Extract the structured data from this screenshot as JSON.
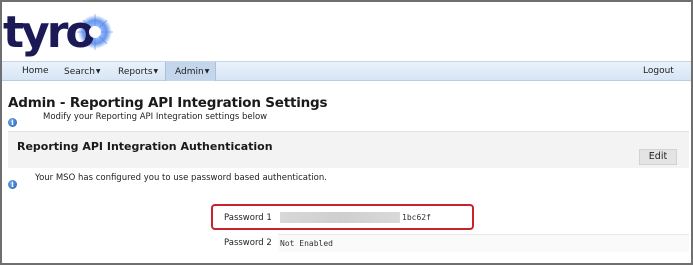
{
  "brand": {
    "logo_text": "tyro",
    "accent": "#1b1a57",
    "burst": "#2f6fe6"
  },
  "nav": {
    "items": [
      {
        "label": "Home",
        "has_caret": false
      },
      {
        "label": "Search",
        "has_caret": true
      },
      {
        "label": "Reports",
        "has_caret": true
      },
      {
        "label": "Admin",
        "has_caret": true,
        "active": true
      }
    ],
    "logout_label": "Logout"
  },
  "page": {
    "title": "Admin - Reporting API Integration Settings",
    "subtitle": "Modify your Reporting API Integration settings below"
  },
  "section": {
    "title": "Reporting API Integration Authentication",
    "edit_label": "Edit",
    "note": "Your MSO has configured you to use password based authentication."
  },
  "passwords": [
    {
      "label": "Password 1",
      "value": "1bc62f",
      "masked": true,
      "highlighted": true
    },
    {
      "label": "Password 2",
      "value": "Not Enabled",
      "masked": false,
      "highlighted": false
    }
  ],
  "icons": {
    "info": "info-icon",
    "caret": "caret-down-icon"
  },
  "colors": {
    "nav_bg": "#dde9f7",
    "highlight_border": "#c8232c",
    "info_blue": "#1d5fb4"
  }
}
